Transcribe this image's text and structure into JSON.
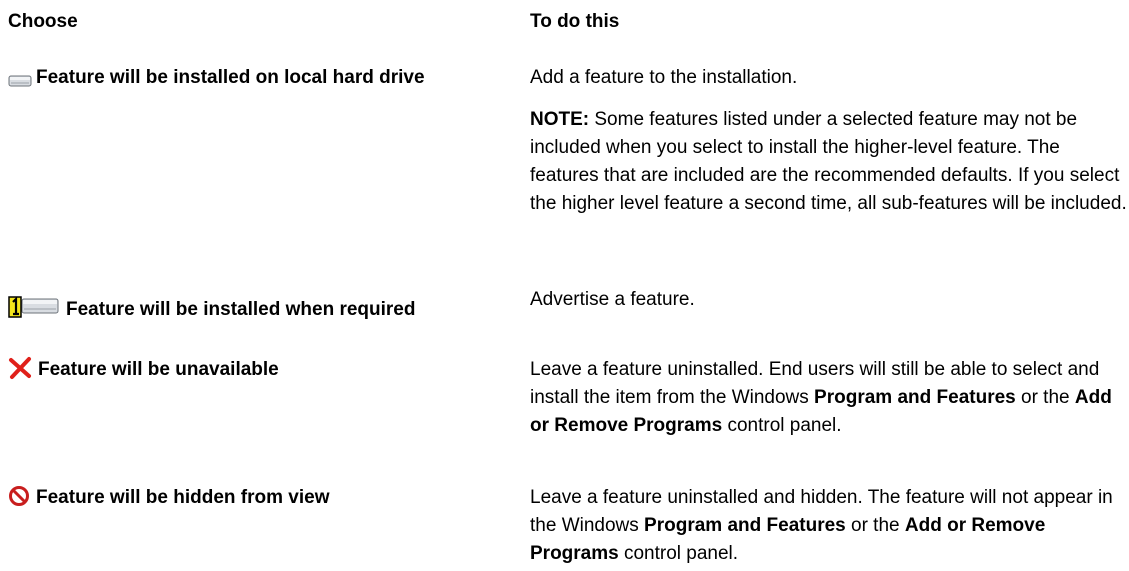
{
  "headers": {
    "choose": "Choose",
    "todo": "To do this"
  },
  "rows": [
    {
      "icon": "hard-drive-icon",
      "choose": "Feature will be installed on local hard drive",
      "desc": "Add a feature to the installation.",
      "note_label": "NOTE:",
      "note_text": " Some features listed under a selected feature may not be included when you select to install the higher-level feature. The features that are included are the recommended defaults. If you select the higher level feature a second time, all sub-features will be included."
    },
    {
      "icon": "advertise-drive-icon",
      "choose": "Feature will be installed when required",
      "desc": "Advertise a feature."
    },
    {
      "icon": "red-x-icon",
      "choose": "Feature will be unavailable",
      "desc_parts": [
        "Leave a feature uninstalled. End users will still be able to select and install the item from the Windows ",
        "Program and Features",
        " or the ",
        "Add or Remove Programs",
        " control panel."
      ]
    },
    {
      "icon": "hidden-icon",
      "choose": "Feature will be hidden from view",
      "desc_parts": [
        "Leave a feature uninstalled and hidden. The feature will not appear in the Windows ",
        "Program and Features",
        " or the ",
        "Add or Remove Programs",
        " control panel."
      ]
    }
  ],
  "colors": {
    "text": "#000000",
    "icon_red": "#e0201a",
    "icon_drive": "#bfc5cc",
    "icon_yellow": "#f4e51c"
  }
}
